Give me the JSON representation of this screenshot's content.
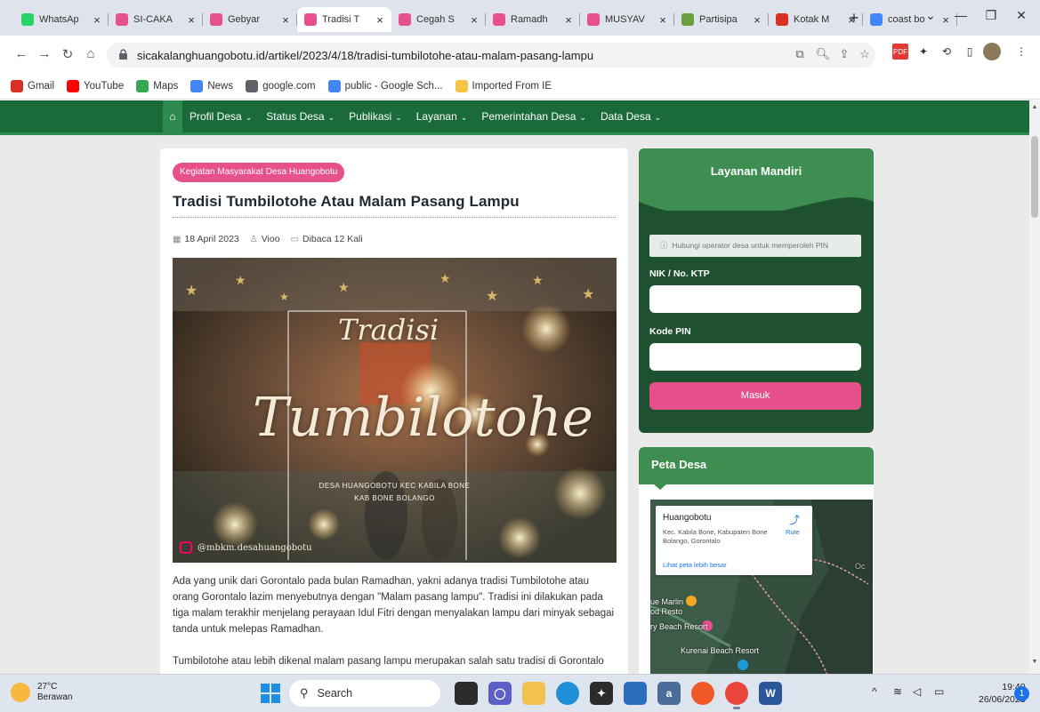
{
  "browser": {
    "tabs": [
      {
        "label": "WhatsAp",
        "icon": "whatsapp-icon",
        "color": "#25d366"
      },
      {
        "label": "SI-CAKA",
        "icon": "site-icon",
        "color": "#e8508b"
      },
      {
        "label": "Gebyar",
        "icon": "site-icon",
        "color": "#e8508b"
      },
      {
        "label": "Tradisi T",
        "icon": "site-icon",
        "color": "#e8508b",
        "active": true
      },
      {
        "label": "Cegah S",
        "icon": "site-icon",
        "color": "#e8508b"
      },
      {
        "label": "Ramadh",
        "icon": "site-icon",
        "color": "#e8508b"
      },
      {
        "label": "MUSYAV",
        "icon": "site-icon",
        "color": "#e8508b"
      },
      {
        "label": "Partisipa",
        "icon": "globe-icon",
        "color": "#6a9e3f"
      },
      {
        "label": "Kotak M",
        "icon": "gmail-icon",
        "color": "#d93025"
      },
      {
        "label": "coast bo",
        "icon": "google-icon",
        "color": "#4285f4"
      }
    ],
    "url": "sicakalanghuangobotu.id/artikel/2023/4/18/tradisi-tumbilotohe-atau-malam-pasang-lampu",
    "bookmarks": [
      {
        "label": "Gmail",
        "icon": "gmail-icon"
      },
      {
        "label": "YouTube",
        "icon": "youtube-icon"
      },
      {
        "label": "Maps",
        "icon": "maps-icon"
      },
      {
        "label": "News",
        "icon": "news-icon"
      },
      {
        "label": "google.com",
        "icon": "globe-icon"
      },
      {
        "label": "public - Google Sch...",
        "icon": "scholar-icon"
      },
      {
        "label": "Imported From IE",
        "icon": "folder-icon"
      }
    ]
  },
  "site": {
    "nav": [
      "Profil Desa",
      "Status Desa",
      "Publikasi",
      "Layanan",
      "Pemerintahan Desa",
      "Data Desa"
    ],
    "accent": "#1b6b3a",
    "pink": "#e8508b"
  },
  "article": {
    "category": "Kegiatan Masyarakat Desa Huangobotu",
    "title": "Tradisi Tumbilotohe Atau Malam Pasang Lampu",
    "date": "18 April 2023",
    "author": "Vioo",
    "views": "Dibaca 12 Kali",
    "photo": {
      "script_small": "Tradisi",
      "script_big": "Tumbilotohe",
      "line1": "DESA HUANGOBOTU KEC KABILA BONE",
      "line2": "KAB BONE BOLANGO",
      "instagram": "@mbkm.desahuangobotu"
    },
    "para1": "Ada yang unik dari Gorontalo pada bulan Ramadhan, yakni adanya tradisi Tumbilotohe atau orang Gorontalo lazim menyebutnya dengan \"Malam pasang lampu\". Tradisi ini dilakukan pada tiga malam terakhir menjelang perayaan Idul Fitri dengan menyalakan lampu dari minyak sebagai tanda untuk melepas Ramadhan.",
    "para2": "Tumbilotohe atau lebih dikenal malam pasang lampu merupakan salah satu tradisi di Gorontalo yang"
  },
  "layanan": {
    "title": "Layanan Mandiri",
    "hint": "Hubungi operator desa untuk memperoleh PIN",
    "nik_label": "NIK / No. KTP",
    "pin_label": "Kode PIN",
    "submit": "Masuk"
  },
  "peta": {
    "title": "Peta Desa",
    "place": "Huangobotu",
    "address": "Kec. Kabila Bone, Kabupaten Bone Bolango, Gorontalo",
    "route": "Rute",
    "link": "Lihat peta lebih besar",
    "labels": [
      "ue Marlin",
      "od Resto",
      "ry Beach Resort",
      "Kurenai Beach Resort",
      "Oc"
    ]
  },
  "taskbar": {
    "temp": "27°C",
    "weather": "Berawan",
    "search": "Search",
    "time": "19:40",
    "date": "26/06/2023",
    "notifications": "1"
  }
}
